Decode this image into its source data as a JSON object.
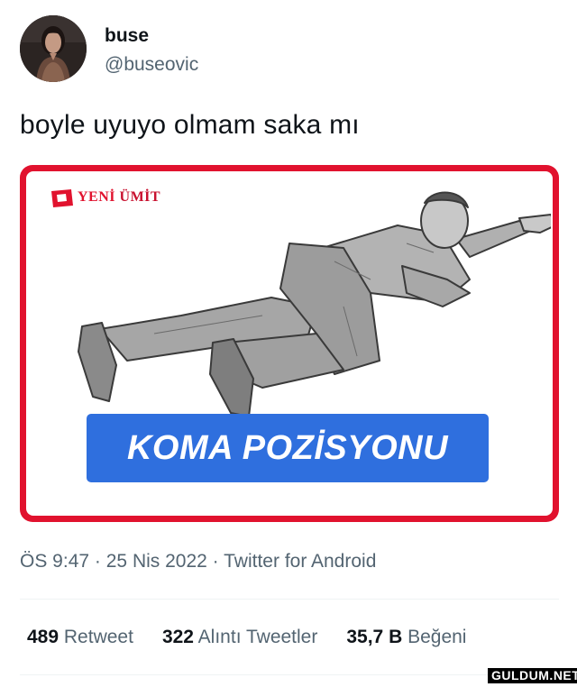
{
  "author": {
    "display_name": "buse",
    "handle": "@buseovic"
  },
  "tweet": {
    "text": "boyle uyuyo olmam saka mı"
  },
  "media": {
    "logo_brand": "YENİ",
    "logo_brand_2": "ÜMİT",
    "banner_text": "KOMA POZİSYONU",
    "frame_color": "#e1122e",
    "banner_color": "#2f6fde"
  },
  "meta": {
    "time": "ÖS 9:47",
    "date": "25 Nis 2022",
    "source": "Twitter for Android",
    "separator": "·"
  },
  "stats": [
    {
      "value": "489",
      "label": "Retweet"
    },
    {
      "value": "322",
      "label": "Alıntı Tweetler"
    },
    {
      "value": "35,7 B",
      "label": "Beğeni"
    }
  ],
  "watermark": "GULDUM.NET"
}
